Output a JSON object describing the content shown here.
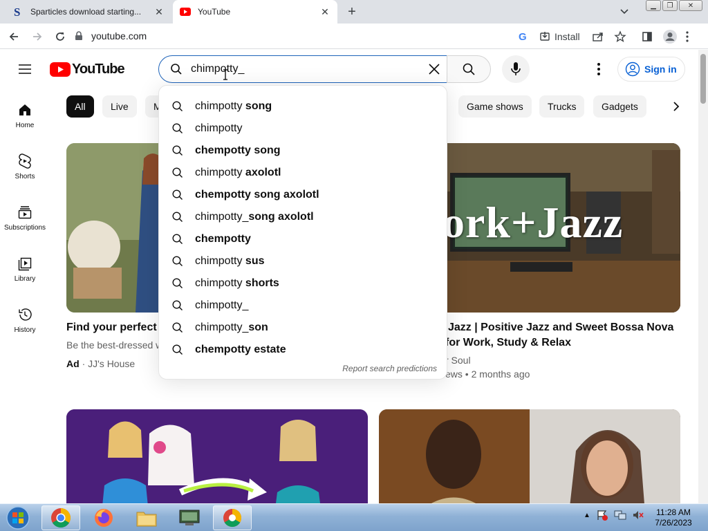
{
  "browser": {
    "tabs": [
      {
        "title": "Sparticles download starting...",
        "favicon": "s-logo-icon"
      },
      {
        "title": "YouTube",
        "favicon": "youtube-icon"
      }
    ],
    "url": "youtube.com",
    "install_label": "Install"
  },
  "youtube": {
    "logo_text": "YouTube",
    "search_value": "chimpotty_",
    "signin_label": "Sign in",
    "guide": [
      {
        "label": "Home",
        "icon": "home-icon"
      },
      {
        "label": "Shorts",
        "icon": "shorts-icon"
      },
      {
        "label": "Subscriptions",
        "icon": "subscriptions-icon"
      },
      {
        "label": "Library",
        "icon": "library-icon"
      },
      {
        "label": "History",
        "icon": "history-icon"
      }
    ],
    "chips": [
      "All",
      "Live",
      "M",
      "Game shows",
      "Trucks",
      "Gadgets"
    ],
    "suggestions": [
      {
        "prefix": "chimpotty",
        "suffix": " song"
      },
      {
        "prefix": "chimpotty",
        "suffix": ""
      },
      {
        "prefix": "",
        "suffix": "chempotty song"
      },
      {
        "prefix": "chimpotty",
        "suffix": " axolotl"
      },
      {
        "prefix": "",
        "suffix": "chempotty song axolotl"
      },
      {
        "prefix": "chimpotty_",
        "suffix": "song axolotl"
      },
      {
        "prefix": "",
        "suffix": "chempotty"
      },
      {
        "prefix": "chimpotty",
        "suffix": " sus"
      },
      {
        "prefix": "chimpotty",
        "suffix": " shorts"
      },
      {
        "prefix": "chimpotty_",
        "suffix": ""
      },
      {
        "prefix": "chimpotty_",
        "suffix": "son"
      },
      {
        "prefix": "",
        "suffix": "chempotty estate"
      }
    ],
    "report_label": "Report search predictions",
    "videos": [
      {
        "title": "Find your perfect R",
        "subtitle": "Be the best-dressed w",
        "ad_label": "Ad",
        "channel": "JJ's House"
      },
      {
        "title_line1": "Jazz | Positive Jazz and Sweet Bossa Nova",
        "title_line2": "for Work, Study & Relax",
        "thumb_text": "ork+Jazz",
        "channel": "r Soul",
        "meta": "ews • 2 months ago"
      }
    ]
  },
  "taskbar": {
    "time": "11:28 AM",
    "date": "7/26/2023"
  },
  "colors": {
    "youtube_red": "#ff0000",
    "link_blue": "#065fd4",
    "search_border": "#1c62b9"
  }
}
